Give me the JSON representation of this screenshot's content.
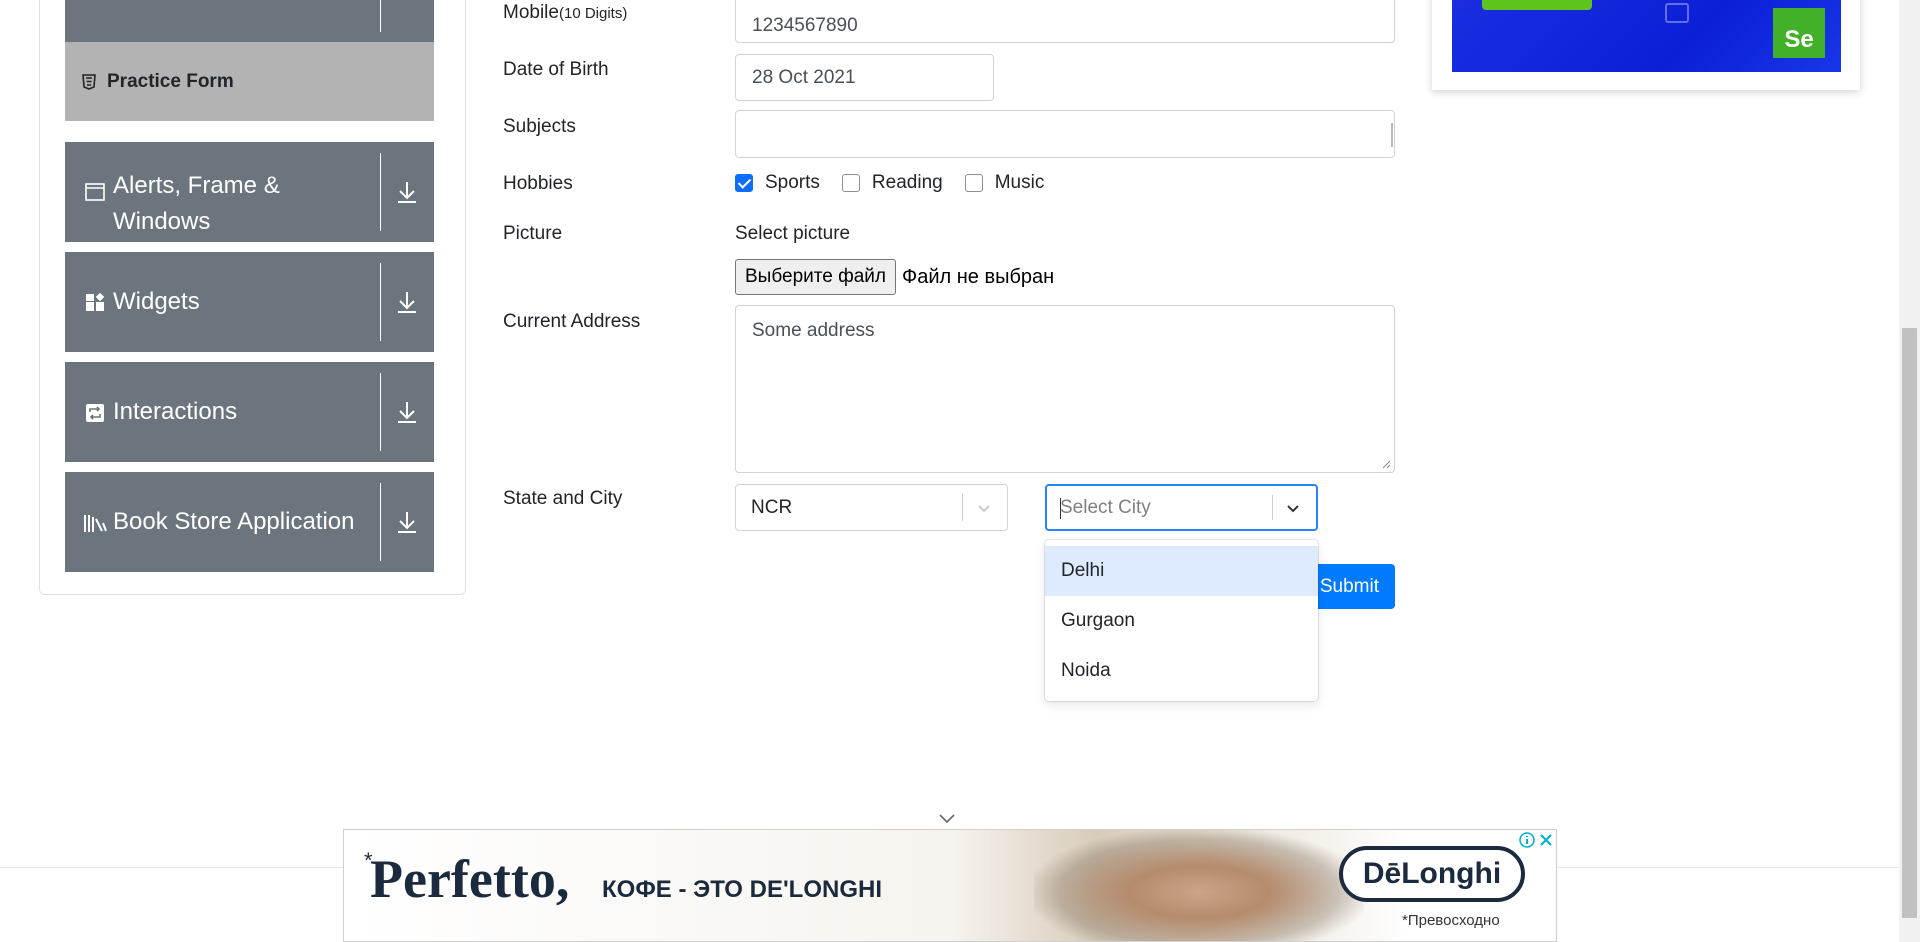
{
  "sidebar": {
    "practice_form": "Practice Form",
    "groups": [
      {
        "label": "Alerts, Frame & Windows",
        "icon": "window-icon"
      },
      {
        "label": "Widgets",
        "icon": "widgets-icon"
      },
      {
        "label": "Interactions",
        "icon": "interactions-icon"
      },
      {
        "label": "Book Store Application",
        "icon": "books-icon"
      }
    ]
  },
  "form": {
    "mobile": {
      "label": "Mobile",
      "hint": "(10 Digits)",
      "value": "1234567890"
    },
    "dob": {
      "label": "Date of Birth",
      "value": "28 Oct 2021"
    },
    "subjects": {
      "label": "Subjects",
      "value": ""
    },
    "hobbies": {
      "label": "Hobbies",
      "options": [
        {
          "label": "Sports",
          "checked": true
        },
        {
          "label": "Reading",
          "checked": false
        },
        {
          "label": "Music",
          "checked": false
        }
      ]
    },
    "picture": {
      "label": "Picture",
      "select_label": "Select picture",
      "button": "Выберите файл",
      "status": "Файл не выбран"
    },
    "address": {
      "label": "Current Address",
      "value": "Some address"
    },
    "state_city": {
      "label": "State and City",
      "state_value": "NCR",
      "city_placeholder": "Select City",
      "city_options": [
        "Delhi",
        "Gurgaon",
        "Noida"
      ],
      "highlighted_option": "Delhi"
    },
    "submit": "Submit"
  },
  "ads": {
    "top_right_badge": "Se",
    "bottom": {
      "brand": "Perfetto,",
      "brand_mark": "*",
      "tagline": "КОФЕ - ЭТО DE'LONGHI",
      "logo": "DēLonghi",
      "footnote": "*Превосходно"
    }
  },
  "colors": {
    "sidebar_group": "#6c757d",
    "sidebar_active": "#b3b3b3",
    "primary": "#007bff",
    "option_highlight": "#deebff",
    "focus_border": "#2684ff"
  }
}
